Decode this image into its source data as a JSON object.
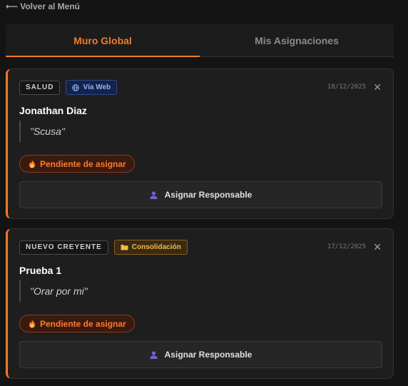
{
  "nav": {
    "back_label": "Volver al Menú"
  },
  "tabs": [
    {
      "label": "Muro Global",
      "active": true
    },
    {
      "label": "Mis Asignaciones",
      "active": false
    }
  ],
  "colors": {
    "accent": "#f47a26",
    "background": "#141414",
    "card": "#1e1e1e"
  },
  "cards": [
    {
      "category": "SALUD",
      "source": {
        "label": "Vía Web",
        "icon": "globe-icon"
      },
      "date": "18/12/2025",
      "name": "Jonathan Diaz",
      "message": "\"Scusa\"",
      "status": {
        "label": "Pendiente de asignar",
        "icon": "fire-icon"
      },
      "action": {
        "label": "Asignar Responsable",
        "icon": "user-icon"
      }
    },
    {
      "category": "NUEVO CREYENTE",
      "source": {
        "label": "Consolidación",
        "icon": "folder-icon"
      },
      "date": "17/12/2025",
      "name": "Prueba 1",
      "message": "\"Orar por mi\"",
      "status": {
        "label": "Pendiente de asignar",
        "icon": "fire-icon"
      },
      "action": {
        "label": "Asignar Responsable",
        "icon": "user-icon"
      }
    }
  ]
}
